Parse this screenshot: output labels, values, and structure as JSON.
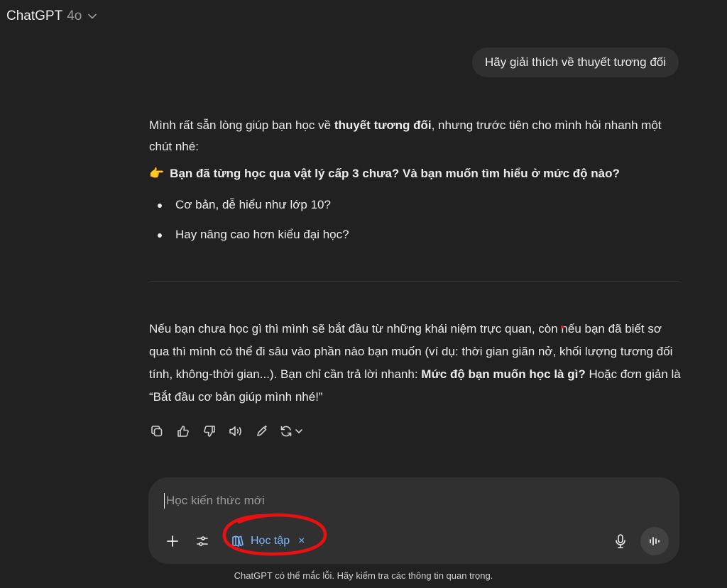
{
  "header": {
    "app_name": "ChatGPT",
    "model_version": "4o"
  },
  "conversation": {
    "user_message": "Hãy giải thích về thuyết tương đối",
    "assistant": {
      "intro_before": "Mình rất sẵn lòng giúp bạn học về ",
      "intro_bold": "thuyết tương đối",
      "intro_after": ", nhưng trước tiên cho mình hỏi nhanh một chút nhé:",
      "question_emoji": "👉",
      "question": "Bạn đã từng học qua vật lý cấp 3 chưa? Và bạn muốn tìm hiểu ở mức độ nào?",
      "options": [
        "Cơ bản, dễ hiểu như lớp 10?",
        "Hay nâng cao hơn kiểu đại học?"
      ],
      "follow_before": "Nếu bạn chưa học gì thì mình sẽ bắt đầu từ những khái niệm trực quan, còn nếu bạn đã biết sơ qua thì mình có thể đi sâu vào phần nào bạn muốn (ví dụ: thời gian giãn nở, khối lượng tương đối tính, không-thời gian...). Bạn chỉ cần trả lời nhanh: ",
      "follow_bold": "Mức độ bạn muốn học là gì?",
      "follow_after": " Hoặc đơn giản là “Bắt đầu cơ bản giúp mình nhé!”"
    },
    "actions": [
      "copy-icon",
      "thumbs-up-icon",
      "thumbs-down-icon",
      "read-aloud-icon",
      "edit-icon",
      "regenerate-icon"
    ]
  },
  "composer": {
    "placeholder": "Học kiến thức mới",
    "tool_chip_label": "Học tập",
    "tool_chip_remove": "×",
    "accent_color": "#7ab7ff"
  },
  "annotation_color": "#e81010",
  "footer": {
    "disclaimer": "ChatGPT có thể mắc lỗi. Hãy kiểm tra các thông tin quan trọng."
  }
}
